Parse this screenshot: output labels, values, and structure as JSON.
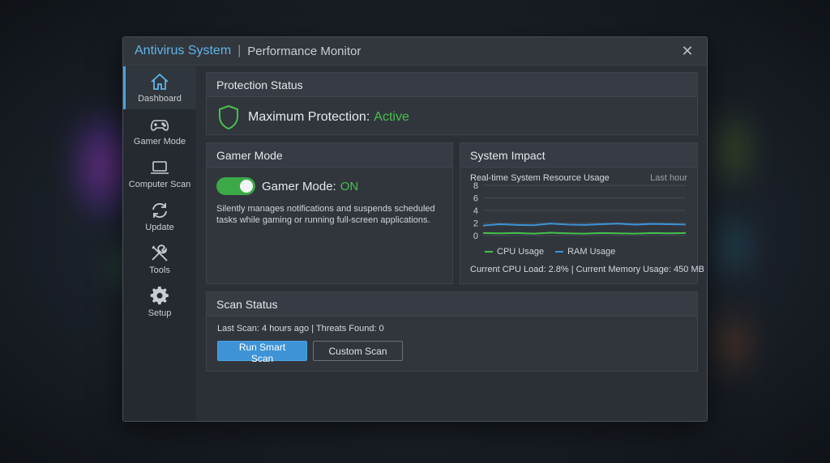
{
  "window": {
    "title_app": "Antivirus System",
    "title_separator": "|",
    "title_sub": "Performance Monitor",
    "close_glyph": "✕"
  },
  "sidebar": {
    "items": [
      {
        "label": "Dashboard",
        "icon": "home-icon",
        "active": true
      },
      {
        "label": "Gamer Mode",
        "icon": "gamepad-icon",
        "active": false
      },
      {
        "label": "Computer Scan",
        "icon": "laptop-icon",
        "active": false
      },
      {
        "label": "Update",
        "icon": "refresh-icon",
        "active": false
      },
      {
        "label": "Tools",
        "icon": "tools-icon",
        "active": false
      },
      {
        "label": "Setup",
        "icon": "gear-icon",
        "active": false
      }
    ]
  },
  "protection": {
    "header": "Protection Status",
    "label": "Maximum Protection:",
    "status": "Active",
    "icon": "shield-icon"
  },
  "gamer": {
    "header": "Gamer Mode",
    "label": "Gamer Mode:",
    "state": "ON",
    "toggle_on": true,
    "description": "Silently manages notifications and suspends scheduled tasks while gaming or running full-screen applications."
  },
  "impact": {
    "header": "System Impact",
    "chart_title": "Real-time System Resource Usage",
    "range": "Last hour",
    "footer": "Current CPU Load: 2.8% | Current Memory Usage: 450 MB"
  },
  "chart_data": {
    "type": "line",
    "title": "Real-time System Resource Usage",
    "ylim": [
      0,
      8
    ],
    "yticks": [
      0,
      2,
      4,
      6,
      8
    ],
    "grid": true,
    "legend": "bottom",
    "x": [
      0,
      1,
      2,
      3,
      4,
      5,
      6,
      7,
      8,
      9,
      10,
      11,
      12
    ],
    "series": [
      {
        "name": "CPU Usage",
        "color": "#45c14a",
        "values": [
          0.4,
          0.35,
          0.4,
          0.3,
          0.45,
          0.35,
          0.3,
          0.4,
          0.35,
          0.3,
          0.4,
          0.35,
          0.4
        ]
      },
      {
        "name": "RAM Usage",
        "color": "#3d93d6",
        "values": [
          1.6,
          1.8,
          1.7,
          1.65,
          1.9,
          1.75,
          1.7,
          1.8,
          1.9,
          1.75,
          1.85,
          1.8,
          1.75
        ]
      }
    ]
  },
  "scan": {
    "header": "Scan Status",
    "info": "Last Scan: 4 hours ago | Threats Found: 0",
    "primary_label": "Run Smart Scan",
    "secondary_label": "Custom Scan"
  },
  "colors": {
    "accent": "#4aa3df",
    "success": "#45c14a"
  }
}
